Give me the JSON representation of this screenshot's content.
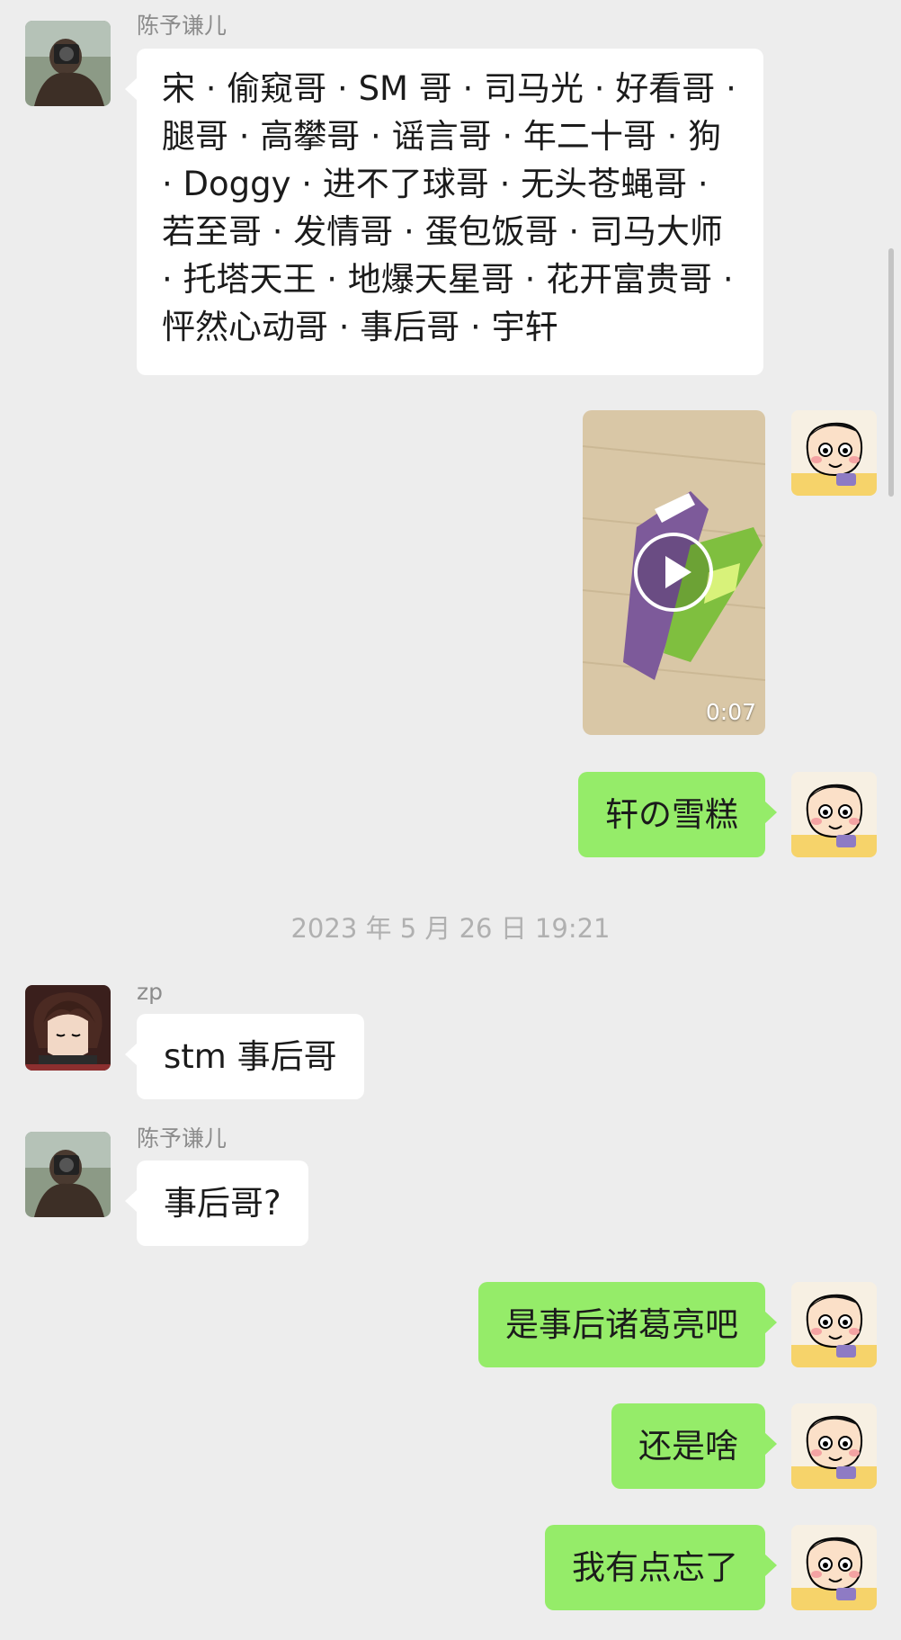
{
  "messages": {
    "m1": {
      "sender": "陈予谦儿",
      "text": "宋 · 偷窥哥 · SM 哥 · 司马光 · 好看哥 · 腿哥 · 高攀哥 · 谣言哥 · 年二十哥 · 狗 · Doggy · 进不了球哥 · 无头苍蝇哥 · 若至哥 · 发情哥 · 蛋包饭哥 · 司马大师 · 托塔天王 · 地爆天星哥 · 花开富贵哥 · 怦然心动哥 · 事后哥 · 宇轩"
    },
    "m2": {
      "video_duration": "0:07"
    },
    "m3": {
      "text": "轩の雪糕"
    },
    "timestamp": "2023 年 5 月 26 日 19:21",
    "m4": {
      "sender": "zp",
      "text": "stm 事后哥"
    },
    "m5": {
      "sender": "陈予谦儿",
      "text": "事后哥?"
    },
    "m6": {
      "text": "是事后诸葛亮吧"
    },
    "m7": {
      "text": "还是啥"
    },
    "m8": {
      "text": "我有点忘了"
    }
  },
  "colors": {
    "background": "#ededed",
    "bubble_self": "#95ec69",
    "bubble_other": "#ffffff"
  }
}
